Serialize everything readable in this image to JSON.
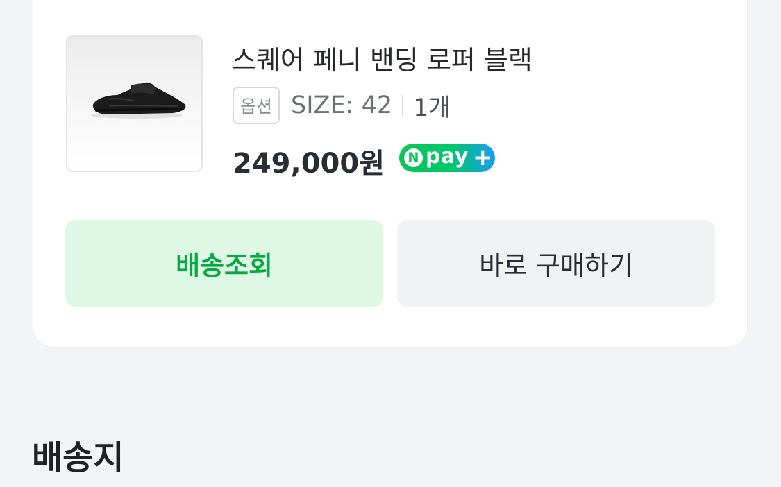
{
  "order_card": {
    "product": {
      "image_icon": "loafer-shoe-image",
      "name": "스퀘어 페니 밴딩 로퍼 블랙",
      "option_badge": "옵션",
      "option_value": "SIZE: 42",
      "quantity": "1개",
      "price": "249,000원",
      "npay_badge": {
        "n": "N",
        "text": "pay",
        "plus": "+"
      }
    },
    "buttons": {
      "track_shipping": "배송조회",
      "buy_again": "바로 구매하기"
    }
  },
  "shipping_section": {
    "title": "배송지"
  },
  "colors": {
    "accent_green": "#0aa842",
    "track_button_bg": "#dff8e5",
    "npay_green": "#08c753",
    "npay_blue": "#1a9cf0"
  }
}
